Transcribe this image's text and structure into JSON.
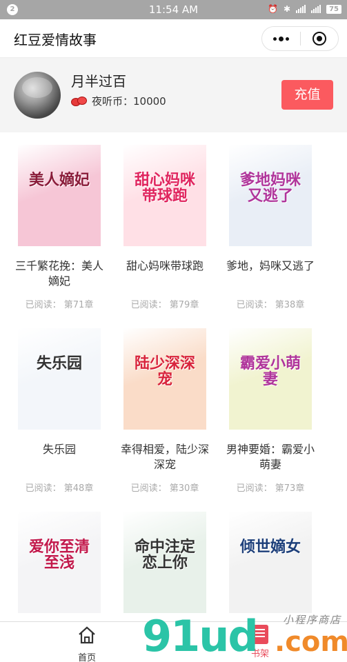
{
  "status_bar": {
    "notification_badge": "2",
    "time": "11:54 AM",
    "battery": "75"
  },
  "nav": {
    "title": "红豆爱情故事",
    "more_icon": "more-dots-icon",
    "close_icon": "target-circle-icon"
  },
  "profile": {
    "username": "月半过百",
    "coin_label": "夜听币：10000",
    "recharge_label": "充值"
  },
  "books": [
    {
      "title": "三千繁花挽：美人嫡妃",
      "progress": "已阅读： 第71章",
      "cover_text": "美人嫡妃",
      "cover_bg": "#f6c6d6",
      "cover_fg": "#8a1c3a"
    },
    {
      "title": "甜心妈咪带球跑",
      "progress": "已阅读： 第79章",
      "cover_text": "甜心妈咪带球跑",
      "cover_bg": "#ffe0e6",
      "cover_fg": "#e0245e"
    },
    {
      "title": "爹地，妈咪又逃了",
      "progress": "已阅读： 第38章",
      "cover_text": "爹地妈咪又逃了",
      "cover_bg": "#e9eef6",
      "cover_fg": "#b0359b"
    },
    {
      "title": "失乐园",
      "progress": "已阅读： 第48章",
      "cover_text": "失乐园",
      "cover_bg": "#f3f6fa",
      "cover_fg": "#333333"
    },
    {
      "title": "幸得相爱，陆少深深宠",
      "progress": "已阅读： 第30章",
      "cover_text": "陆少深深宠",
      "cover_bg": "#fadcc8",
      "cover_fg": "#d8243c"
    },
    {
      "title": "男神要婚：霸爱小萌妻",
      "progress": "已阅读： 第73章",
      "cover_text": "霸爱小萌妻",
      "cover_bg": "#f1f3d0",
      "cover_fg": "#b0359b"
    },
    {
      "title": "",
      "progress": "",
      "cover_text": "爱你至清至浅",
      "cover_bg": "#f4f4f6",
      "cover_fg": "#c2184b"
    },
    {
      "title": "",
      "progress": "",
      "cover_text": "命中注定恋上你",
      "cover_bg": "#e8f1ea",
      "cover_fg": "#333333"
    },
    {
      "title": "",
      "progress": "",
      "cover_text": "倾世嫡女",
      "cover_bg": "#f2f2f2",
      "cover_fg": "#1d3f7a"
    }
  ],
  "tabbar": {
    "home_label": "首页",
    "shelf_label": "书架"
  },
  "watermark": {
    "brand": "91ud",
    "suffix": ".com",
    "tagline": "小程序商店"
  }
}
